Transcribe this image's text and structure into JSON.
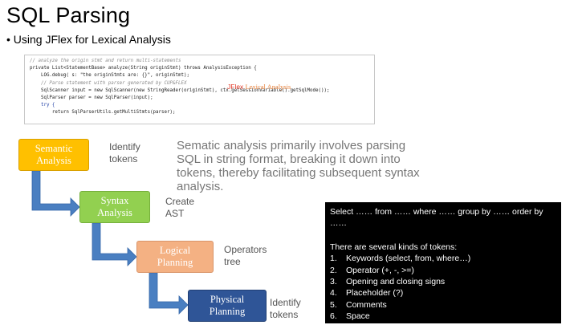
{
  "slide": {
    "title": "SQL Parsing",
    "bullet": "• Using JFlex for Lexical Analysis"
  },
  "code": {
    "lines": [
      "// analyze the origin stmt and return multi-statements",
      "private List<StatementBase> analyze(String originStmt) throws AnalysisException {",
      "    LOG.debug( s: \"the originStmts are: {}\", originStmt);",
      "    // Parse statement with parser generated by CUP&FLEX",
      "    SqlScanner input = new SqlScanner(new StringReader(originStmt), ctx.getSessionVariable().getSqlMode());",
      "    SqlParser parser = new SqlParser(input);",
      "    try {",
      "        return SqlParserUtils.getMultiStmts(parser);"
    ],
    "annotation_main": "JFlex",
    "annotation_sub": "Lexical Analysis"
  },
  "stages": [
    {
      "label": "Semantic\nAnalysis",
      "note": "Identify\ntokens",
      "color": "#ffc000"
    },
    {
      "label": "Syntax\nAnalysis",
      "note": "Create\nAST",
      "color": "#92d050"
    },
    {
      "label": "Logical\nPlanning",
      "note": "Operators\ntree",
      "color": "#f4b183"
    },
    {
      "label": "Physical\nPlanning",
      "note": "Identify\ntokens",
      "color": "#2f5597"
    }
  ],
  "description": "Sematic analysis primarily involves parsing SQL in string format, breaking it down into tokens, thereby facilitating subsequent syntax analysis.",
  "tokens": {
    "query": "Select …… from …… where …… group by …… order by ……",
    "intro": "There are several kinds of tokens:",
    "items": [
      {
        "num": "1.",
        "text": "Keywords (select, from, where…)"
      },
      {
        "num": "2.",
        "text": "Operator (+, -, >=)"
      },
      {
        "num": "3.",
        "text": "Opening and closing signs"
      },
      {
        "num": "4.",
        "text": "Placeholder (?)"
      },
      {
        "num": "5.",
        "text": "Comments"
      },
      {
        "num": "6.",
        "text": "Space"
      }
    ]
  },
  "colors": {
    "arrow": "#4a7fc1",
    "arrow_stroke": "#3466a8"
  }
}
